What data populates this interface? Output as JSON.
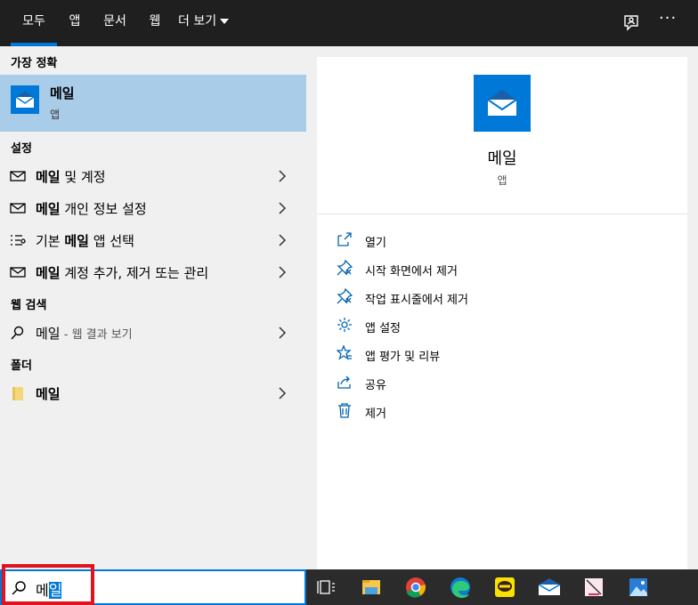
{
  "tabs": [
    {
      "label": "모두",
      "active": true
    },
    {
      "label": "앱"
    },
    {
      "label": "문서"
    },
    {
      "label": "웹"
    },
    {
      "label": "더 보기"
    }
  ],
  "top_icons": {
    "feedback": "feedback-icon",
    "more": "···"
  },
  "left": {
    "best_match": {
      "heading": "가장 정확",
      "name": "메일",
      "type": "앱",
      "icon": "mail-app-icon"
    },
    "settings": {
      "heading": "설정",
      "items": [
        {
          "bold": "메일",
          "rest": " 및 계정",
          "icon": "envelope-icon"
        },
        {
          "bold": "메일",
          "rest": " 개인 정보 설정",
          "icon": "envelope-icon"
        },
        {
          "pre": "기본 ",
          "bold": "메일",
          "rest": " 앱 선택",
          "icon": "list-settings-icon"
        },
        {
          "bold": "메일",
          "rest": " 계정 추가, 제거 또는 관리",
          "icon": "envelope-icon"
        }
      ]
    },
    "web": {
      "heading": "웹 검색",
      "query": "메일",
      "suffix": " - 웹 결과 보기",
      "icon": "search-icon"
    },
    "folders": {
      "heading": "폴더",
      "name": "메일",
      "icon": "folder-icon"
    }
  },
  "detail": {
    "name": "메일",
    "type": "앱",
    "actions": [
      {
        "label": "열기",
        "icon": "open-icon"
      },
      {
        "label": "시작 화면에서 제거",
        "icon": "unpin-icon"
      },
      {
        "label": "작업 표시줄에서 제거",
        "icon": "unpin-icon"
      },
      {
        "label": "앱 설정",
        "icon": "gear-icon"
      },
      {
        "label": "앱 평가 및 리뷰",
        "icon": "star-icon"
      },
      {
        "label": "공유",
        "icon": "share-icon"
      },
      {
        "label": "제거",
        "icon": "trash-icon"
      }
    ]
  },
  "search": {
    "typed": "메",
    "selected": "일"
  },
  "taskbar": [
    "task-view-icon",
    "file-explorer-icon",
    "chrome-icon",
    "edge-icon",
    "kakaotalk-icon",
    "mail-icon",
    "paint-icon",
    "photos-icon"
  ],
  "colors": {
    "accent": "#0078d7",
    "highlight": "#a9cce9",
    "topbar": "#1f1f1f",
    "taskbar": "#2b2b2b",
    "annotation": "#e0141e"
  }
}
